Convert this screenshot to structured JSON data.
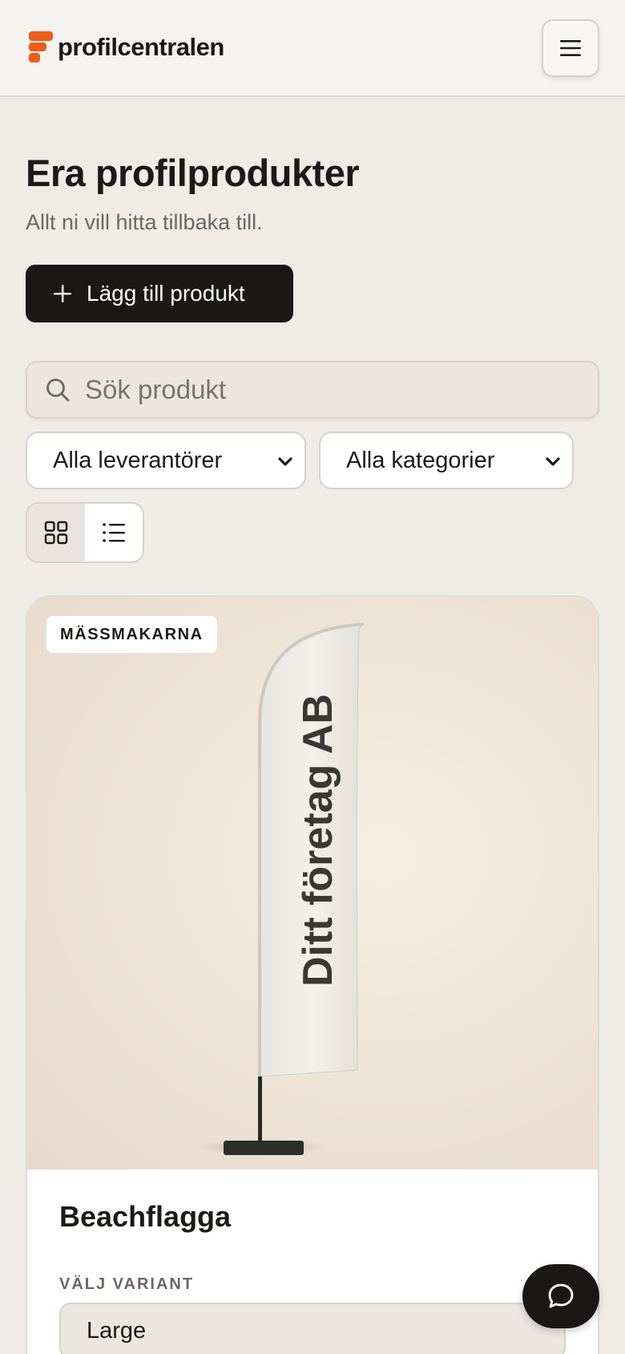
{
  "header": {
    "logo_text": "profilcentralen",
    "menu_icon": "hamburger-icon",
    "brand_color": "#f05a1a"
  },
  "main": {
    "title": "Era profilprodukter",
    "subtitle": "Allt ni vill hitta tillbaka till.",
    "add_button_label": "Lägg till produkt",
    "search": {
      "placeholder": "Sök produkt",
      "value": ""
    },
    "filters": {
      "supplier": {
        "selected": "Alla leverantörer"
      },
      "category": {
        "selected": "Alla kategorier"
      }
    },
    "view_toggle": {
      "options": [
        "grid",
        "list"
      ],
      "active": "grid"
    }
  },
  "products": [
    {
      "supplier_badge": "MÄSSMAKARNA",
      "flag_text": "Ditt företag AB",
      "name": "Beachflagga",
      "variant_label": "VÄLJ VARIANT",
      "variant_selected": "Large"
    }
  ],
  "chat": {
    "icon": "chat-bubble-icon"
  }
}
